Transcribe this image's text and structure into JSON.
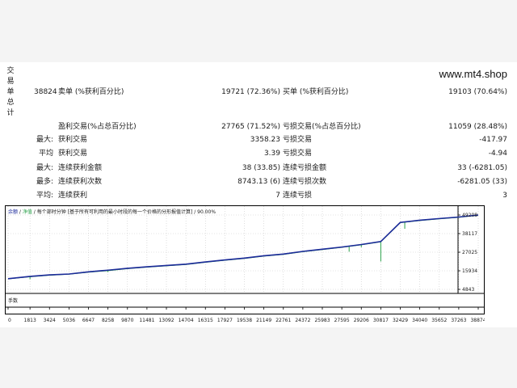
{
  "site": "www.mt4.shop",
  "summary": {
    "side_label": [
      "交",
      "易",
      "单",
      "总",
      "计"
    ],
    "total_trades": "38824",
    "short_label": "卖单 (%获利百分比)",
    "short_value": "19721 (72.36%)",
    "long_label": "买单 (%获利百分比)",
    "long_value": "19103 (70.64%)"
  },
  "rows": [
    {
      "prefix": "",
      "l_label": "盈利交易(%占总百分比)",
      "l_value": "27765 (71.52%)",
      "r_label": "亏损交易(%占总百分比)",
      "r_value": "11059 (28.48%)"
    },
    {
      "prefix": "最大:",
      "l_label": "获利交易",
      "l_value": "3358.23",
      "r_label": "亏损交易",
      "r_value": "-417.97"
    },
    {
      "prefix": "平均",
      "l_label": "获利交易",
      "l_value": "3.39",
      "r_label": "亏损交易",
      "r_value": "-4.94"
    },
    {
      "prefix": "最大:",
      "l_label": "连续获利金额",
      "l_value": "38 (33.85)",
      "r_label": "连续亏损金额",
      "r_value": "33 (-6281.05)"
    },
    {
      "prefix": "最多:",
      "l_label": "连续获利次数",
      "l_value": "8743.13 (6)",
      "r_label": "连续亏损次数",
      "r_value": "-6281.05 (33)"
    },
    {
      "prefix": "平均:",
      "l_label": "连续获利",
      "l_value": "7",
      "r_label": "连续亏损",
      "r_value": "3"
    }
  ],
  "chart": {
    "legend_balance": "余额",
    "legend_sep": " / ",
    "legend_equity": "净值",
    "legend_rest": " / 每个部时分钟 [基于所有可利用的最小时段的每一个价格的分形报值计算] / 90.00%",
    "lots_label": "手数",
    "colors": {
      "balance": "#1c2a9a",
      "equity": "#2aa04a",
      "grid": "#c8c8c8",
      "axis": "#000000"
    }
  },
  "chart_data": {
    "type": "line",
    "x": [
      0,
      1813,
      3424,
      5036,
      6647,
      8258,
      9870,
      11481,
      13092,
      14704,
      16315,
      17927,
      19538,
      21149,
      22761,
      24372,
      25983,
      27595,
      29206,
      30817,
      32429,
      34040,
      35652,
      37263,
      38874
    ],
    "x_ticks": [
      "0",
      "1813",
      "3424",
      "5036",
      "6647",
      "8258",
      "9870",
      "11481",
      "13092",
      "14704",
      "16315",
      "17927",
      "19538",
      "21149",
      "22761",
      "24372",
      "25983",
      "27595",
      "29206",
      "30817",
      "32429",
      "34040",
      "35652",
      "37263",
      "38874"
    ],
    "y_ticks": [
      "49208",
      "38117",
      "27025",
      "15934",
      "4843"
    ],
    "ylim": [
      4843,
      49208
    ],
    "series": [
      {
        "name": "余额",
        "values": [
          11200,
          12600,
          13500,
          14000,
          15300,
          16300,
          17400,
          18300,
          19100,
          19900,
          21200,
          22400,
          23500,
          24900,
          25900,
          27500,
          28800,
          30100,
          31600,
          33400,
          44800,
          46100,
          47100,
          48000,
          49208
        ]
      },
      {
        "name": "净值",
        "values": [
          11100,
          12400,
          13300,
          13900,
          15100,
          16000,
          17200,
          18100,
          18900,
          19700,
          21000,
          22200,
          23300,
          24700,
          25700,
          27300,
          28600,
          29900,
          31400,
          33200,
          44600,
          45900,
          46900,
          47800,
          49100
        ]
      }
    ],
    "equity_drops": [
      {
        "x": 1813,
        "y": 10900
      },
      {
        "x": 8258,
        "y": 15200
      },
      {
        "x": 28200,
        "y": 27300
      },
      {
        "x": 29206,
        "y": 30000
      },
      {
        "x": 30817,
        "y": 21500
      },
      {
        "x": 32800,
        "y": 41000
      }
    ]
  }
}
